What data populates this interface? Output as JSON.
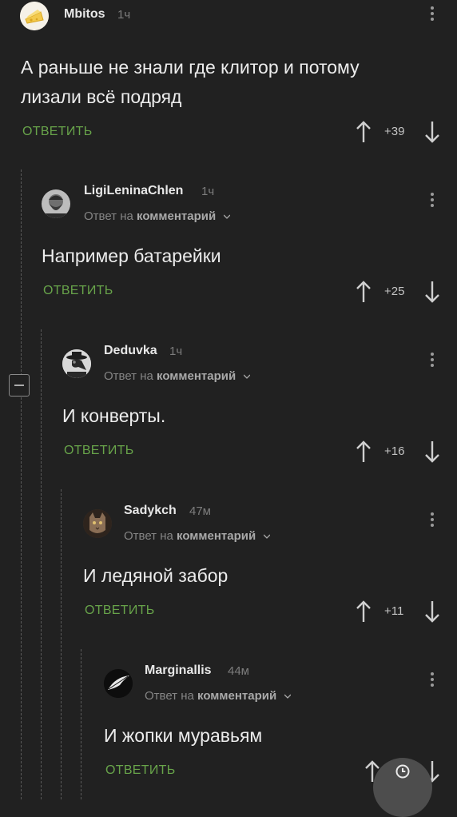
{
  "comments": [
    {
      "author": "Mbitos",
      "time": "1ч",
      "text_lines": [
        "А раньше не знали где клитор и потому",
        "лизали всё подряд"
      ],
      "reply_label": "ОТВЕТИТЬ",
      "score": "+39",
      "reply_prefix": "",
      "reply_target": "",
      "avatar_icon": "cheese-avatar"
    },
    {
      "author": "LigiLeninaChlen",
      "time": "1ч",
      "text_lines": [
        "Например батарейки"
      ],
      "reply_label": "ОТВЕТИТЬ",
      "score": "+25",
      "reply_prefix": "Ответ на",
      "reply_target": "комментарий",
      "avatar_icon": "bearded-man-avatar"
    },
    {
      "author": "Deduvka",
      "time": "1ч",
      "text_lines": [
        "И конверты."
      ],
      "reply_label": "ОТВЕТИТЬ",
      "score": "+16",
      "reply_prefix": "Ответ на",
      "reply_target": "комментарий",
      "avatar_icon": "plague-doctor-avatar"
    },
    {
      "author": "Sadykch",
      "time": "47м",
      "text_lines": [
        "И ледяной забор"
      ],
      "reply_label": "ОТВЕТИТЬ",
      "score": "+11",
      "reply_prefix": "Ответ на",
      "reply_target": "комментарий",
      "avatar_icon": "cat-avatar"
    },
    {
      "author": "Marginallis",
      "time": "44м",
      "text_lines": [
        "И жопки муравьям"
      ],
      "reply_label": "ОТВЕТИТЬ",
      "score": "",
      "reply_prefix": "Ответ на",
      "reply_target": "комментарий",
      "avatar_icon": "feather-avatar"
    }
  ],
  "icons": {
    "upvote": "arrow-up-icon",
    "downvote": "arrow-down-icon",
    "more": "more-vertical-icon",
    "collapse": "collapse-minus-icon",
    "history": "clock-icon"
  },
  "colors": {
    "background": "#212121",
    "reply_green": "#68a44a",
    "text": "#ececec",
    "muted": "#7d7d7d"
  }
}
